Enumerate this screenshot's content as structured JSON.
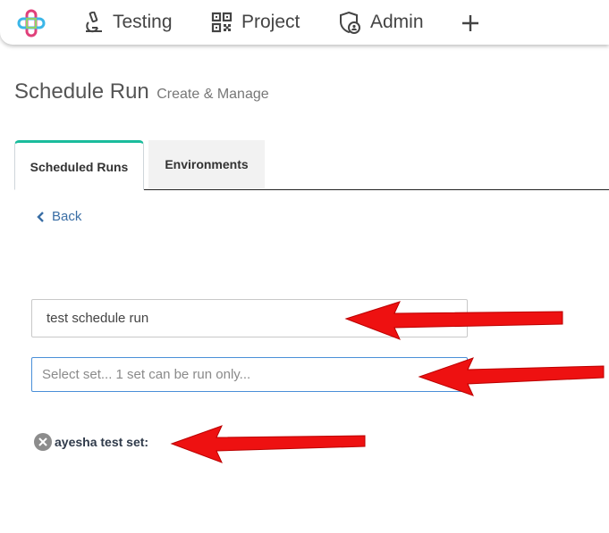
{
  "nav": {
    "items": [
      {
        "label": "Testing",
        "icon": "microscope-icon"
      },
      {
        "label": "Project",
        "icon": "qr-code-icon"
      },
      {
        "label": "Admin",
        "icon": "shield-user-icon"
      }
    ],
    "add_icon": "plus-icon"
  },
  "page": {
    "title": "Schedule Run",
    "subtitle": "Create & Manage"
  },
  "tabs": [
    {
      "label": "Scheduled Runs",
      "active": true
    },
    {
      "label": "Environments",
      "active": false
    }
  ],
  "back": {
    "label": "Back"
  },
  "form": {
    "name_value": "test schedule run",
    "set_placeholder": "Select set... 1 set can be run only..."
  },
  "selected_set": {
    "label": "ayesha test set:"
  },
  "colors": {
    "tab_accent": "#1abc9c",
    "link": "#3a6ea5",
    "focus_border": "#4a8fd8",
    "annotation_arrow": "#ee1111"
  }
}
